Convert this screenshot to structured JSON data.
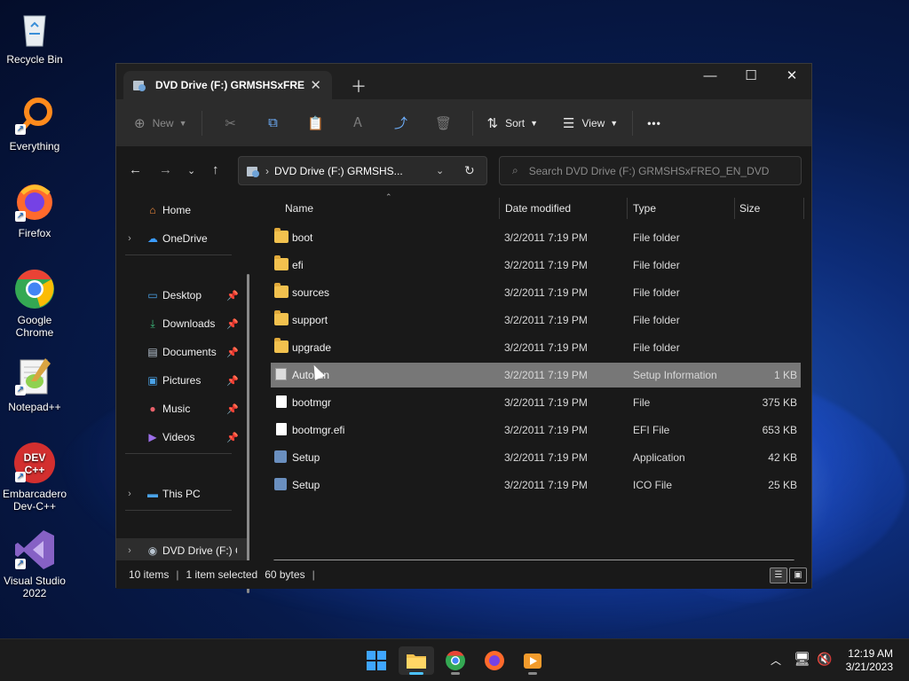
{
  "desktop": {
    "icons": [
      {
        "label": "Recycle Bin"
      },
      {
        "label": "Everything"
      },
      {
        "label": "Firefox"
      },
      {
        "label": "Google Chrome"
      },
      {
        "label": "Notepad++"
      },
      {
        "label": "Embarcadero Dev-C++"
      },
      {
        "label": "Visual Studio 2022"
      }
    ]
  },
  "window": {
    "tab_title": "DVD Drive (F:) GRMSHSxFREO_EN_DVD",
    "toolbar": {
      "new_label": "New",
      "sort_label": "Sort",
      "view_label": "View",
      "more_label": "•••"
    },
    "address": {
      "path": "DVD Drive (F:) GRMSHS...",
      "search_placeholder": "Search DVD Drive (F:) GRMSHSxFREO_EN_DVD"
    },
    "sidebar": {
      "home": "Home",
      "onedrive": "OneDrive",
      "quick": [
        {
          "label": "Desktop"
        },
        {
          "label": "Downloads"
        },
        {
          "label": "Documents"
        },
        {
          "label": "Pictures"
        },
        {
          "label": "Music"
        },
        {
          "label": "Videos"
        }
      ],
      "thispc": "This PC",
      "dvd": "DVD Drive (F:) G"
    },
    "columns": {
      "name": "Name",
      "date": "Date modified",
      "type": "Type",
      "size": "Size"
    },
    "files": [
      {
        "name": "boot",
        "date": "3/2/2011 7:19 PM",
        "type": "File folder",
        "size": "",
        "icon": "folder-icon"
      },
      {
        "name": "efi",
        "date": "3/2/2011 7:19 PM",
        "type": "File folder",
        "size": "",
        "icon": "folder-icon"
      },
      {
        "name": "sources",
        "date": "3/2/2011 7:19 PM",
        "type": "File folder",
        "size": "",
        "icon": "folder-icon"
      },
      {
        "name": "support",
        "date": "3/2/2011 7:19 PM",
        "type": "File folder",
        "size": "",
        "icon": "folder-icon"
      },
      {
        "name": "upgrade",
        "date": "3/2/2011 7:19 PM",
        "type": "File folder",
        "size": "",
        "icon": "folder-icon"
      },
      {
        "name": "Autorun",
        "date": "3/2/2011 7:19 PM",
        "type": "Setup Information",
        "size": "1 KB",
        "icon": "setup-info-icon",
        "selected": true
      },
      {
        "name": "bootmgr",
        "date": "3/2/2011 7:19 PM",
        "type": "File",
        "size": "375 KB",
        "icon": "file-icon"
      },
      {
        "name": "bootmgr.efi",
        "date": "3/2/2011 7:19 PM",
        "type": "EFI File",
        "size": "653 KB",
        "icon": "file-icon"
      },
      {
        "name": "Setup",
        "date": "3/2/2011 7:19 PM",
        "type": "Application",
        "size": "42 KB",
        "icon": "setup-app-icon"
      },
      {
        "name": "Setup",
        "date": "3/2/2011 7:19 PM",
        "type": "ICO File",
        "size": "25 KB",
        "icon": "setup-app-icon"
      }
    ],
    "status": {
      "count": "10 items",
      "selected": "1 item selected",
      "bytes": "60 bytes"
    }
  },
  "taskbar": {
    "time": "12:19 AM",
    "date": "3/21/2023"
  },
  "colors": {
    "accent": "#4cc2ff",
    "selection": "#777777",
    "folder": "#f2c14e"
  }
}
